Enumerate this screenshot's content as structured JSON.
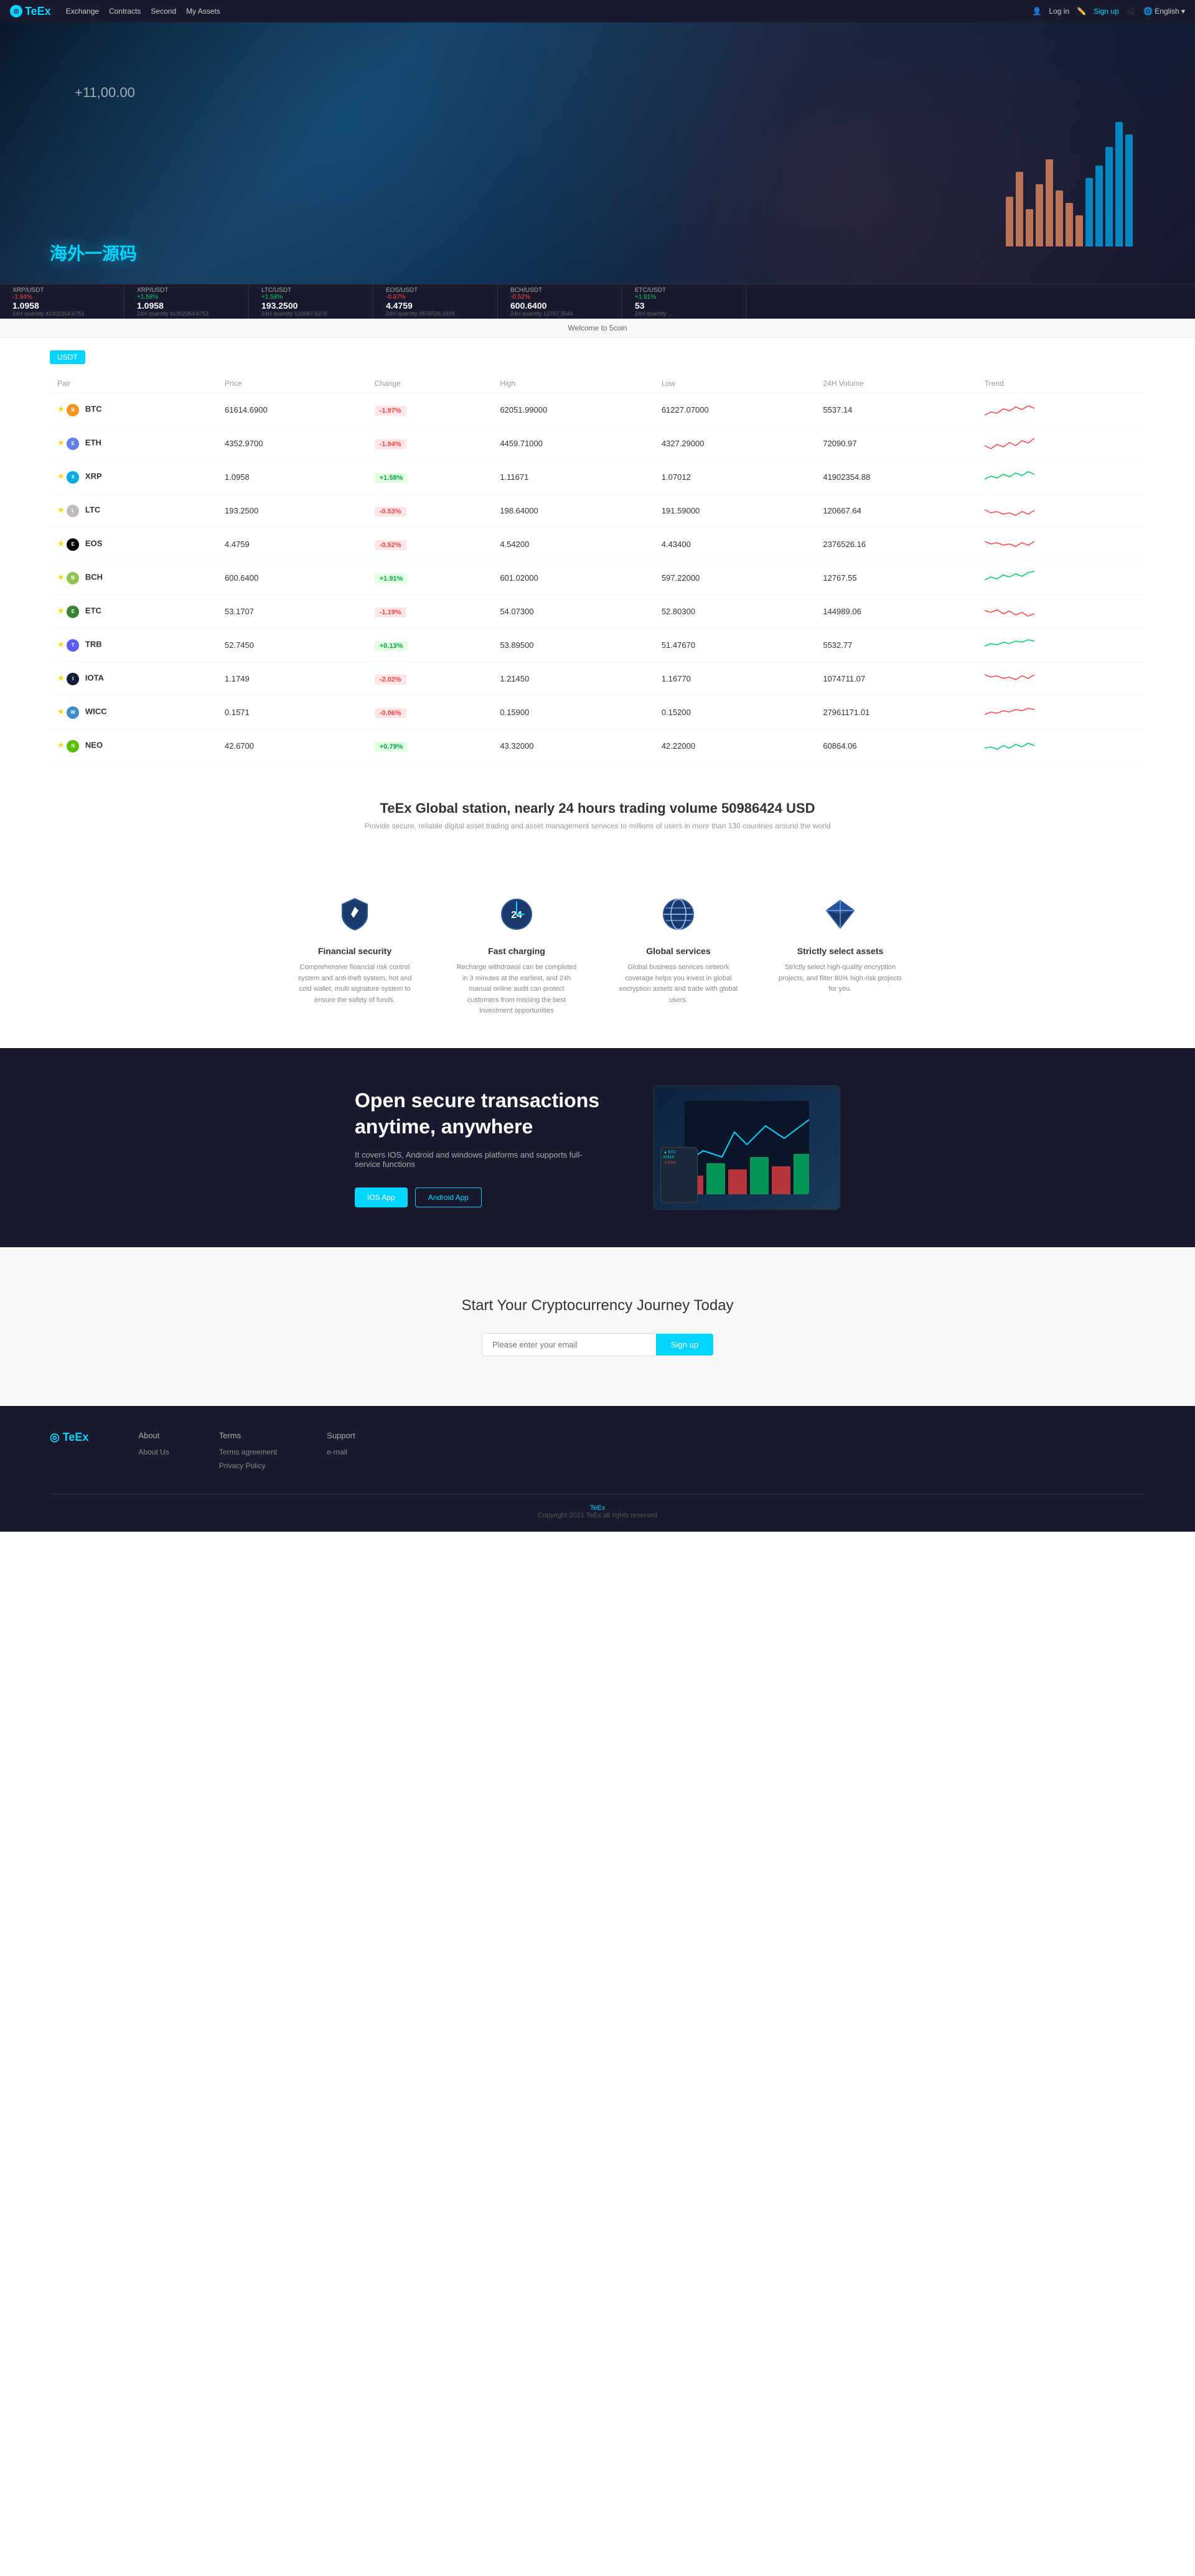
{
  "nav": {
    "logo": "TeEx",
    "links": [
      "Exchange",
      "Contracts",
      "Second",
      "My Assets"
    ],
    "login": "Log in",
    "signup": "Sign up",
    "lang": "English"
  },
  "ticker": [
    {
      "pair": "XRP/USDT",
      "change": "-1.94%",
      "price": "1.0958",
      "volume": "24H quantity 41902354.6751",
      "positive": false
    },
    {
      "pair": "XRP/USDT",
      "change": "+1.58%",
      "price": "1.0958",
      "volume": "24H quantity 41902354.6751",
      "positive": true
    },
    {
      "pair": "LTC/USDT",
      "change": "+1.58%",
      "price": "193.2500",
      "volume": "24H quantity 120667.6376",
      "positive": true
    },
    {
      "pair": "EOS/USDT",
      "change": "-0.87%",
      "price": "4.4759",
      "volume": "24H quantity 2876526.1629",
      "positive": false
    },
    {
      "pair": "BCH/USDT",
      "change": "-0.52%",
      "price": "600.6400",
      "volume": "24H quantity 12767.3544",
      "positive": false
    },
    {
      "pair": "ETC/USDT",
      "change": "+1.91%",
      "price": "53",
      "volume": "24H quantity ...",
      "positive": true
    }
  ],
  "welcome": "Welcome to 5coin",
  "usdt_tab": "USDT",
  "table": {
    "headers": [
      "Pair",
      "Price",
      "Change",
      "High",
      "Low",
      "24H Volume",
      "Trend"
    ],
    "rows": [
      {
        "coin": "BTC",
        "color": "coin-btc",
        "symbol": "B",
        "price": "61614.6900",
        "change": "-1.97%",
        "positive": false,
        "high": "62051.99000",
        "low": "61227.07000",
        "volume": "5537.14"
      },
      {
        "coin": "ETH",
        "color": "coin-eth",
        "symbol": "E",
        "price": "4352.9700",
        "change": "-1.94%",
        "positive": false,
        "high": "4459.71000",
        "low": "4327.29000",
        "volume": "72090.97"
      },
      {
        "coin": "XRP",
        "color": "coin-xrp",
        "symbol": "X",
        "price": "1.0958",
        "change": "+1.58%",
        "positive": true,
        "high": "1.11671",
        "low": "1.07012",
        "volume": "41902354.88"
      },
      {
        "coin": "LTC",
        "color": "coin-ltc",
        "symbol": "L",
        "price": "193.2500",
        "change": "-0.53%",
        "positive": false,
        "high": "198.64000",
        "low": "191.59000",
        "volume": "120667.64"
      },
      {
        "coin": "EOS",
        "color": "coin-eos",
        "symbol": "E",
        "price": "4.4759",
        "change": "-0.52%",
        "positive": false,
        "high": "4.54200",
        "low": "4.43400",
        "volume": "2376526.16"
      },
      {
        "coin": "BCH",
        "color": "coin-bch",
        "symbol": "B",
        "price": "600.6400",
        "change": "+1.91%",
        "positive": true,
        "high": "601.02000",
        "low": "597.22000",
        "volume": "12767.55"
      },
      {
        "coin": "ETC",
        "color": "coin-etc",
        "symbol": "E",
        "price": "53.1707",
        "change": "-1.19%",
        "positive": false,
        "high": "54.07300",
        "low": "52.80300",
        "volume": "144989.06"
      },
      {
        "coin": "TRB",
        "color": "coin-trb",
        "symbol": "T",
        "price": "52.7450",
        "change": "+0.13%",
        "positive": true,
        "high": "53.89500",
        "low": "51.47670",
        "volume": "5532.77"
      },
      {
        "coin": "IOTA",
        "color": "coin-iota",
        "symbol": "I",
        "price": "1.1749",
        "change": "-2.02%",
        "positive": false,
        "high": "1.21450",
        "low": "1.16770",
        "volume": "1074711.07"
      },
      {
        "coin": "WICC",
        "color": "coin-wicc",
        "symbol": "W",
        "price": "0.1571",
        "change": "-0.06%",
        "positive": false,
        "high": "0.15900",
        "low": "0.15200",
        "volume": "27961171.01"
      },
      {
        "coin": "NEO",
        "color": "coin-neo",
        "symbol": "N",
        "price": "42.6700",
        "change": "+0.79%",
        "positive": true,
        "high": "43.32000",
        "low": "42.22000",
        "volume": "60864.06"
      }
    ]
  },
  "stats": {
    "prefix": "TeEx Global station, nearly 24 hours trading volume",
    "volume": "50986424",
    "suffix": "USD",
    "subtitle": "Provide secure, reliable digital asset trading and asset management services to millions of users in more than 130 countries around the world"
  },
  "features": [
    {
      "id": "financial-security",
      "title": "Financial security",
      "desc": "Comprehensive financial risk control system and anti-theft system, hot and cold wallet, multi signature system to ensure the safety of funds."
    },
    {
      "id": "fast-charging",
      "title": "Fast charging",
      "desc": "Recharge withdrawal can be completed in 3 minutes at the earliest, and 24h manual online audit can protect customers from missing the best investment opportunities"
    },
    {
      "id": "global-services",
      "title": "Global services",
      "desc": "Global business services network coverage helps you invest in global encryption assets and trade with global users."
    },
    {
      "id": "strictly-select",
      "title": "Strictly select assets",
      "desc": "Strictly select high-quality encryption projects, and filter 80% high-risk projects for you."
    }
  ],
  "app": {
    "title": "Open secure transactions anytime, anywhere",
    "desc": "It covers IOS, Android and windows platforms and supports full-service functions",
    "ios_btn": "IOS App",
    "android_btn": "Android App"
  },
  "signup_section": {
    "title": "Start Your Cryptocurrency Journey Today",
    "placeholder": "Please enter your email",
    "btn_label": "Sign up"
  },
  "footer": {
    "logo": "TeEx",
    "columns": [
      {
        "heading": "About",
        "links": [
          "About Us"
        ]
      },
      {
        "heading": "Terms",
        "links": [
          "Terms agreement",
          "Privacy Policy"
        ]
      },
      {
        "heading": "Support",
        "links": [
          "e-mail"
        ]
      }
    ],
    "bottom": "TeEx",
    "copyright": "Copyright 2021 TeEx all rights reserved"
  }
}
